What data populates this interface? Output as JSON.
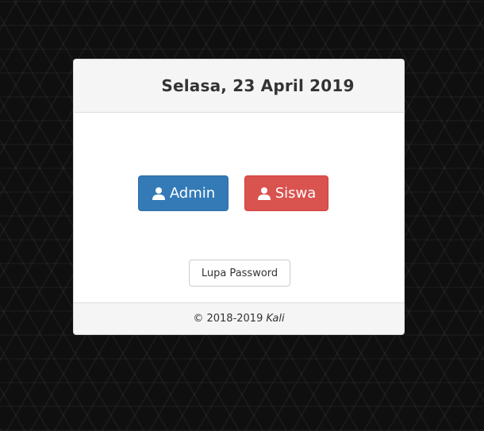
{
  "header": {
    "date": "Selasa, 23 April 2019"
  },
  "roles": {
    "admin_label": "Admin",
    "siswa_label": "Siswa",
    "admin_color": "#337ab7",
    "siswa_color": "#d9534f"
  },
  "actions": {
    "forgot_password_label": "Lupa Password"
  },
  "footer": {
    "copyright": "© 2018-2019",
    "author": "Kali"
  }
}
